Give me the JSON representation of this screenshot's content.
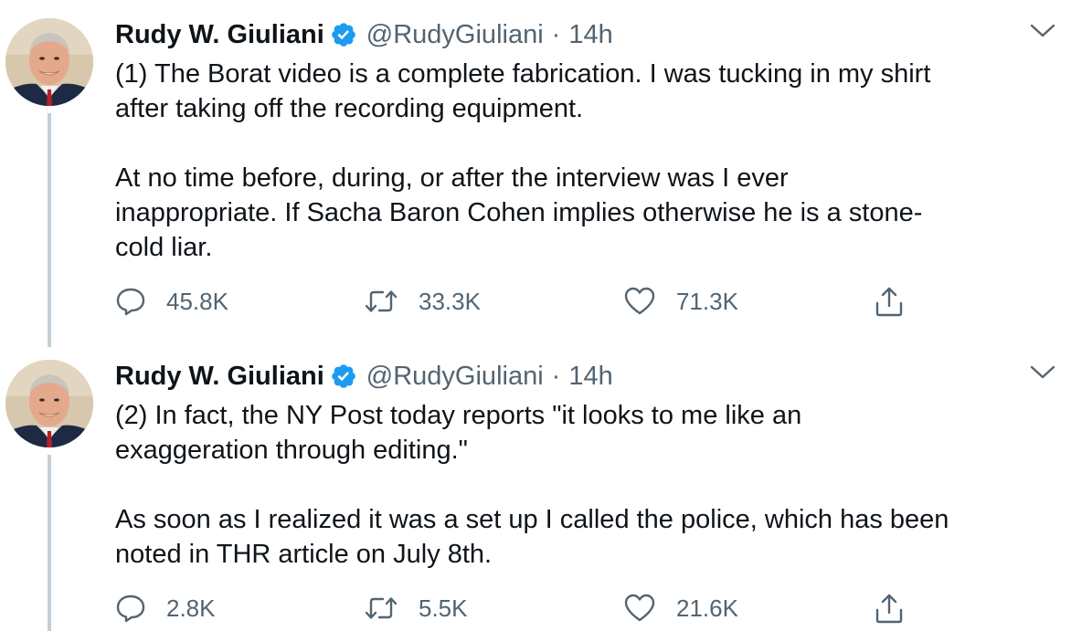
{
  "tweets": [
    {
      "author": {
        "name": "Rudy W. Giuliani",
        "handle": "@RudyGiuliani",
        "verified": true
      },
      "time": "14h",
      "paragraphs": [
        "(1) The Borat video is a complete fabrication. I was tucking in my shirt\nafter taking off the recording equipment.",
        "At no time before, during, or after the interview was I ever\ninappropriate. If Sacha Baron Cohen implies otherwise he is a stone-\ncold liar."
      ],
      "stats": {
        "replies": "45.8K",
        "retweets": "33.3K",
        "likes": "71.3K"
      }
    },
    {
      "author": {
        "name": "Rudy W. Giuliani",
        "handle": "@RudyGiuliani",
        "verified": true
      },
      "time": "14h",
      "paragraphs": [
        "(2) In fact, the NY Post today reports \"it looks to me like an\nexaggeration through editing.\"",
        "As soon as I realized it was a set up I called the police, which has been\nnoted in THR article on July 8th."
      ],
      "stats": {
        "replies": "2.8K",
        "retweets": "5.5K",
        "likes": "21.6K"
      }
    }
  ],
  "separator": "·",
  "icons": {
    "verified": "verified-badge-icon",
    "caret": "chevron-down-icon",
    "reply": "reply-icon",
    "retweet": "retweet-icon",
    "like": "heart-icon",
    "share": "share-icon"
  },
  "colors": {
    "text": "#0f1419",
    "secondary": "#536471",
    "verified": "#1d9bf0",
    "thread_line": "#c4cfd6"
  }
}
